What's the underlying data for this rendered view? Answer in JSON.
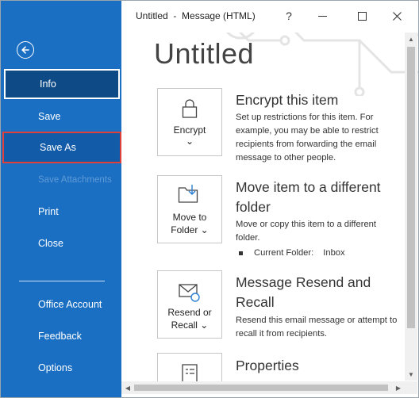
{
  "window": {
    "title": "Untitled  -  Message (HTML)",
    "help_label": "?"
  },
  "sidebar": {
    "items": [
      {
        "label": "Info"
      },
      {
        "label": "Save"
      },
      {
        "label": "Save As"
      },
      {
        "label": "Save Attachments"
      },
      {
        "label": "Print"
      },
      {
        "label": "Close"
      },
      {
        "label": "Office Account"
      },
      {
        "label": "Feedback"
      },
      {
        "label": "Options"
      }
    ]
  },
  "main": {
    "page_title": "Untitled",
    "sections": [
      {
        "button_label_1": "Encrypt",
        "button_label_2": "⌄",
        "title": "Encrypt this item",
        "description": "Set up restrictions for this item. For example, you may be able to restrict recipients from forwarding the email message to other people."
      },
      {
        "button_label_1": "Move to",
        "button_label_2": "Folder ⌄",
        "title_line_1": "Move item to a different",
        "title_line_2": "folder",
        "description": "Move or copy this item to a different folder.",
        "bullet_label": "Current Folder:",
        "bullet_value": "Inbox"
      },
      {
        "button_label_1": "Resend or",
        "button_label_2": "Recall ⌄",
        "title_line_1": "Message Resend and",
        "title_line_2": "Recall",
        "description": "Resend this email message or attempt to recall it from recipients."
      },
      {
        "title": "Properties"
      }
    ]
  },
  "colors": {
    "sidebar_bg": "#1a6fc3",
    "selected_bg": "#0e4a86",
    "highlight_border": "#e0403a"
  }
}
